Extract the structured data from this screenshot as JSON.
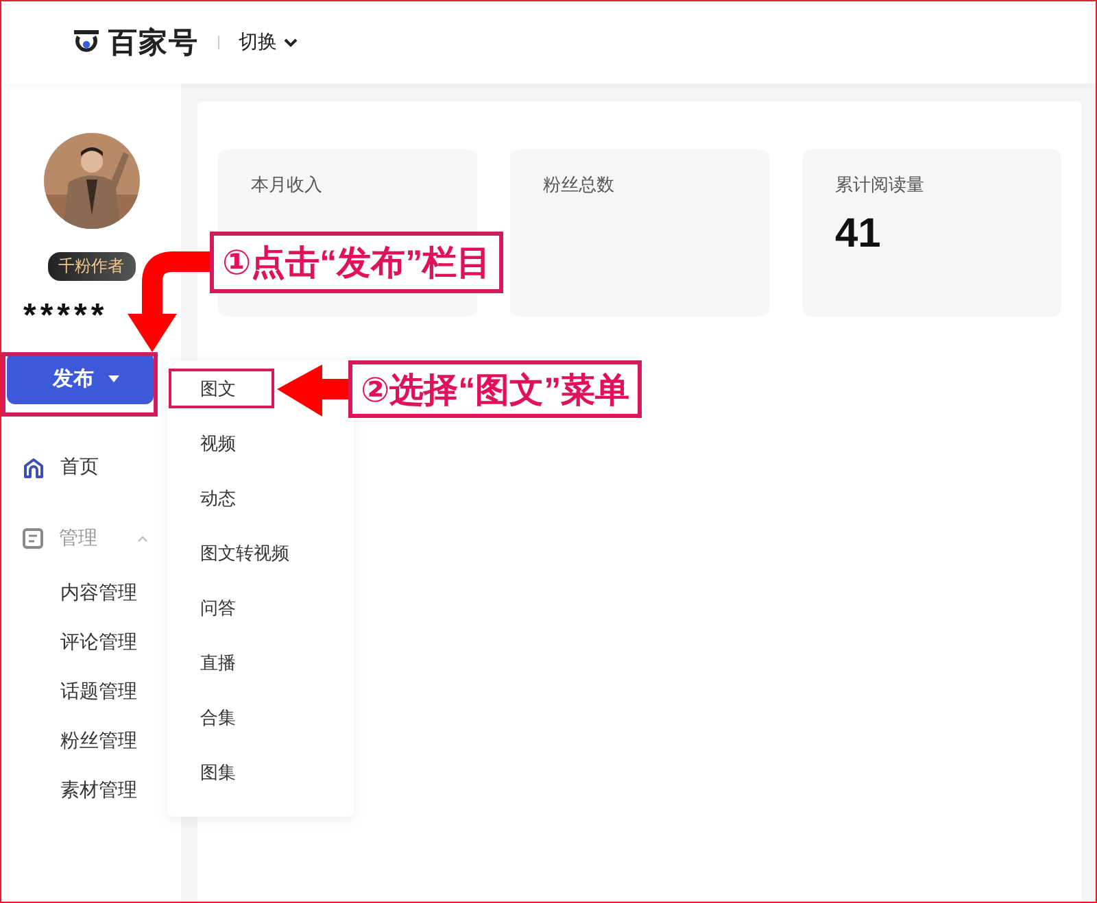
{
  "header": {
    "logo_text": "百家号",
    "switch_label": "切换"
  },
  "profile": {
    "badge": "千粉作者",
    "name": "*****"
  },
  "publish_button": {
    "label": "发布"
  },
  "nav": [
    {
      "kind": "home",
      "label": "首页",
      "selected": true
    },
    {
      "kind": "manage",
      "label": "管理",
      "selected": false,
      "expanded": true,
      "children": [
        {
          "label": "内容管理"
        },
        {
          "label": "评论管理"
        },
        {
          "label": "话题管理"
        },
        {
          "label": "粉丝管理"
        },
        {
          "label": "素材管理"
        }
      ]
    }
  ],
  "stats": [
    {
      "label": "本月收入"
    },
    {
      "label": "粉丝总数"
    },
    {
      "label": "累计阅读量",
      "value": "41"
    }
  ],
  "publish_menu": [
    {
      "label": "图文"
    },
    {
      "label": "视频"
    },
    {
      "label": "动态"
    },
    {
      "label": "图文转视频"
    },
    {
      "label": "问答"
    },
    {
      "label": "直播"
    },
    {
      "label": "合集"
    },
    {
      "label": "图集"
    }
  ],
  "annotations": [
    {
      "text": "①点击“发布”栏目"
    },
    {
      "text": "②选择“图文”菜单"
    }
  ]
}
